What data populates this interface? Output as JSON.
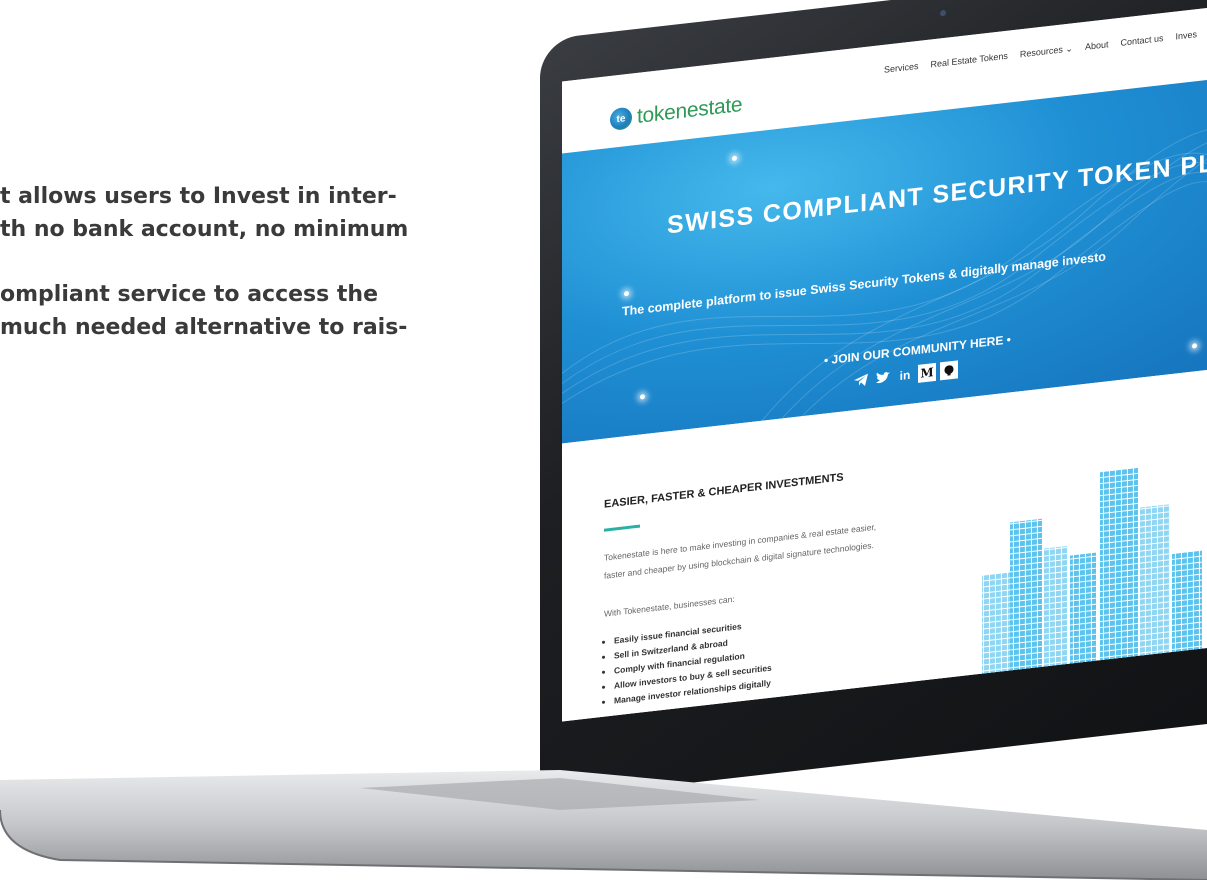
{
  "intro": {
    "line1": "t allows users to Invest in inter-",
    "line2": "th no bank account, no minimum",
    "line3": "ompliant service to access the",
    "line4": "much needed alternative to rais-"
  },
  "site": {
    "logo_mark": "te",
    "logo_text": "tokenestate",
    "nav": [
      "Services",
      "Real Estate Tokens",
      "Resources ⌄",
      "About",
      "Contact us",
      "Inves"
    ],
    "hero_title": "SWISS COMPLIANT SECURITY TOKEN PLATFORM",
    "hero_subtitle": "The complete platform to issue Swiss Security Tokens & digitally manage investo",
    "community": "• JOIN OUR COMMUNITY HERE •",
    "socials": [
      "telegram-icon",
      "twitter-icon",
      "linkedin-icon",
      "medium-icon",
      "github-icon"
    ],
    "linkedin_label": "in",
    "medium_label": "M",
    "section_title": "EASIER, FASTER & CHEAPER INVESTMENTS",
    "section_paragraph": "Tokenestate is here to make investing in companies & real estate easier, faster and cheaper by using blockchain & digital signature technologies.",
    "section_lead": "With Tokenestate, businesses can:",
    "bullets": [
      "Easily issue financial securities",
      "Sell in Switzerland & abroad",
      "Comply with financial regulation",
      "Allow investors to buy & sell securities",
      "Manage investor relationships digitally"
    ]
  },
  "colors": {
    "hero_blue": "#1f8fd4",
    "brand_green": "#2f9a58",
    "accent_teal": "#2bb0a6",
    "city_blue": "#5bc3ee"
  }
}
